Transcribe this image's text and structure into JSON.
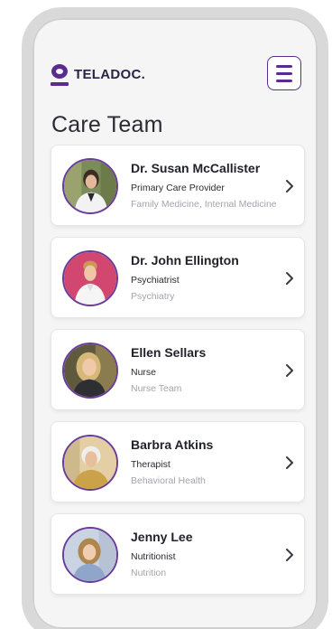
{
  "app": {
    "brand": "TELADOC",
    "brand_dot": ".",
    "brand_color": "#5b2c8f",
    "menu_icon": "hamburger-menu-icon"
  },
  "page": {
    "title": "Care Team"
  },
  "care_team": [
    {
      "name": "Dr. Susan McCallister",
      "role": "Primary Care Provider",
      "specialty": "Family Medicine, Internal Medicine"
    },
    {
      "name": "Dr. John Ellington",
      "role": "Psychiatrist",
      "specialty": "Psychiatry"
    },
    {
      "name": "Ellen Sellars",
      "role": "Nurse",
      "specialty": "Nurse Team"
    },
    {
      "name": "Barbra Atkins",
      "role": "Therapist",
      "specialty": "Behavioral Health"
    },
    {
      "name": "Jenny Lee",
      "role": "Nutritionist",
      "specialty": "Nutrition"
    }
  ],
  "colors": {
    "accent": "#5b2c8f",
    "muted_text": "#a4a4ad",
    "background": "#f5f5f6"
  }
}
